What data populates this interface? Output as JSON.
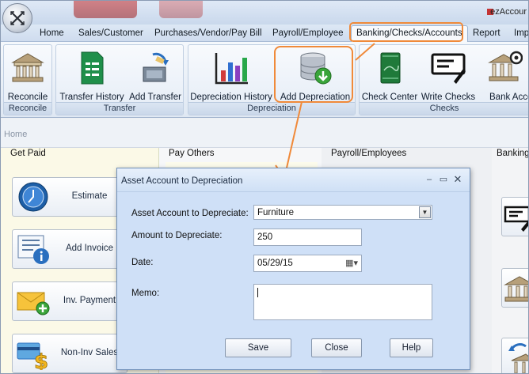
{
  "app": {
    "title": "ezAccour"
  },
  "menu": {
    "tabs": [
      {
        "label": "Home"
      },
      {
        "label": "Sales/Customer"
      },
      {
        "label": "Purchases/Vendor/Pay Bill"
      },
      {
        "label": "Payroll/Employee"
      },
      {
        "label": "Banking/Checks/Accounts"
      },
      {
        "label": "Report"
      },
      {
        "label": "Imp"
      }
    ],
    "active_tab": "Banking/Checks/Accounts"
  },
  "ribbon": {
    "groups": [
      {
        "label": "Reconcile",
        "buttons": [
          {
            "label": "Reconcile",
            "icon": "bank-icon"
          }
        ]
      },
      {
        "label": "Transfer",
        "buttons": [
          {
            "label": "Transfer History",
            "icon": "spreadsheet-icon"
          },
          {
            "label": "Add Transfer",
            "icon": "transfer-icon"
          }
        ]
      },
      {
        "label": "Depreciation",
        "buttons": [
          {
            "label": "Depreciation History",
            "icon": "bar-chart-icon"
          },
          {
            "label": "Add Depreciation",
            "icon": "database-down-icon"
          }
        ]
      },
      {
        "label": "Checks",
        "buttons": [
          {
            "label": "Check Center",
            "icon": "checkbook-icon"
          },
          {
            "label": "Write Checks",
            "icon": "write-check-icon"
          },
          {
            "label": "Bank Accou",
            "icon": "bank-gear-icon"
          }
        ]
      }
    ]
  },
  "breadcrumb": "Home",
  "columns": {
    "get_paid": {
      "header": "Get Paid",
      "tiles": [
        "Estimate",
        "Add Invoice",
        "Inv. Payment",
        "Non-Inv Sales"
      ]
    },
    "pay_others": {
      "header": "Pay Others"
    },
    "payroll": {
      "header": "Payroll/Employees"
    },
    "banking": {
      "header": "Banking"
    }
  },
  "dialog": {
    "title": "Asset Account to Depreciation",
    "fields": {
      "account_label": "Asset Account to Depreciate:",
      "account_value": "Furniture",
      "amount_label": "Amount to Depreciate:",
      "amount_value": "250",
      "date_label": "Date:",
      "date_value": "05/29/15",
      "memo_label": "Memo:",
      "memo_value": ""
    },
    "buttons": {
      "save": "Save",
      "close": "Close",
      "help": "Help"
    }
  },
  "colors": {
    "highlight": "#f08a3a",
    "dialog_bg": "#cfe0f7"
  }
}
